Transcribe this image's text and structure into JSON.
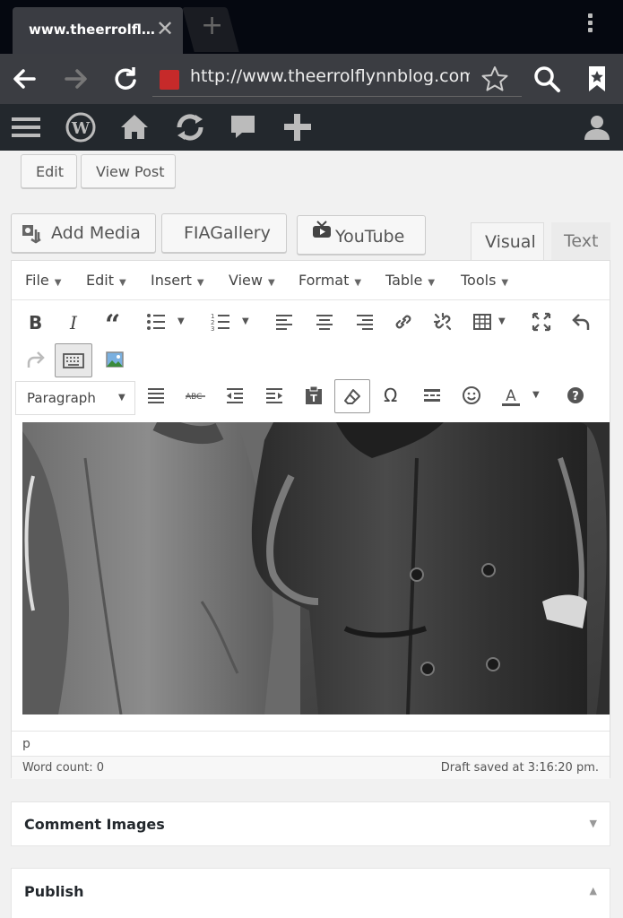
{
  "browser": {
    "tab_title": "www.theerrolfl…",
    "url": "http://www.theerrolflynnblog.com"
  },
  "post_actions": {
    "edit_label": "Edit",
    "view_post_label": "View Post"
  },
  "media_buttons": {
    "add_media_label": "Add Media",
    "fiagallery_label": "FIAGallery",
    "youtube_label": "YouTube"
  },
  "editor_tabs": {
    "visual_label": "Visual",
    "text_label": "Text"
  },
  "menu": {
    "items": [
      "File",
      "Edit",
      "Insert",
      "View",
      "Format",
      "Table",
      "Tools"
    ]
  },
  "toolbar": {
    "format_select": "Paragraph"
  },
  "status": {
    "path": "p",
    "word_count": "Word count: 0",
    "draft_saved": "Draft saved at 3:16:20 pm."
  },
  "meta_boxes": {
    "comment_images": "Comment Images",
    "publish": "Publish"
  },
  "colors": {
    "admin_bar": "#23282d",
    "browser_bar": "#3b3d42",
    "tab_strip": "#050810"
  }
}
